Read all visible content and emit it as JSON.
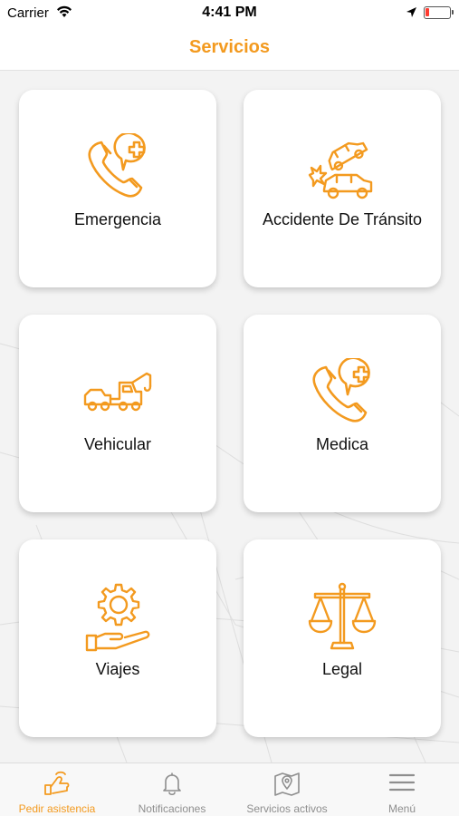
{
  "status_bar": {
    "carrier": "Carrier",
    "time": "4:41 PM"
  },
  "header": {
    "title": "Servicios"
  },
  "services": [
    {
      "label": "Emergencia",
      "icon": "phone-medical-icon"
    },
    {
      "label": "Accidente De Tránsito",
      "icon": "car-accident-icon"
    },
    {
      "label": "Vehicular",
      "icon": "tow-truck-icon"
    },
    {
      "label": "Medica",
      "icon": "phone-medical-icon"
    },
    {
      "label": "Viajes",
      "icon": "gear-hand-icon"
    },
    {
      "label": "Legal",
      "icon": "scales-icon"
    }
  ],
  "tab_bar": {
    "tabs": [
      {
        "label": "Pedir asistencia",
        "icon": "hand-assist-icon",
        "active": true
      },
      {
        "label": "Notificaciones",
        "icon": "bell-icon",
        "active": false
      },
      {
        "label": "Servicios activos",
        "icon": "map-pin-icon",
        "active": false
      },
      {
        "label": "Menú",
        "icon": "hamburger-menu-icon",
        "active": false
      }
    ]
  },
  "colors": {
    "accent": "#f39a1f",
    "inactive": "#8e8e8e",
    "background": "#f3f3f3"
  }
}
